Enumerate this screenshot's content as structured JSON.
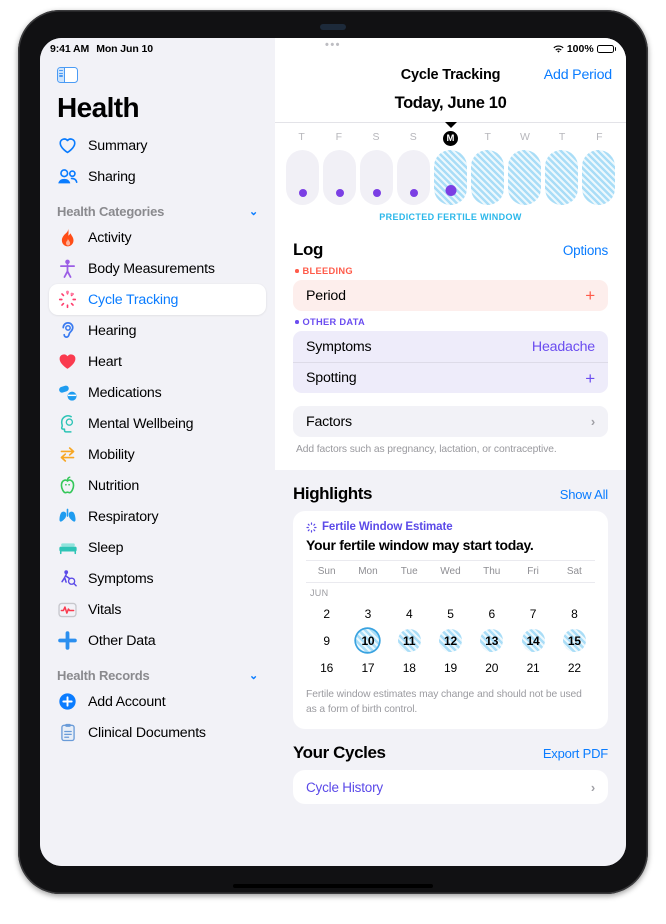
{
  "statusbar": {
    "time": "9:41 AM",
    "date": "Mon Jun 10",
    "dots": "•••",
    "battery_pct": "100%",
    "wifi_icon": "wifi-icon",
    "battery_icon": "battery-icon"
  },
  "sidebar": {
    "toggle_icon": "sidebar-toggle-icon",
    "app_title": "Health",
    "top_items": [
      {
        "label": "Summary",
        "icon": "heart-outline-icon",
        "color": "#0a7cff"
      },
      {
        "label": "Sharing",
        "icon": "people-icon",
        "color": "#0a7cff"
      }
    ],
    "categories_header": {
      "label": "Health Categories",
      "chevron": "chevron-down-icon"
    },
    "categories": [
      {
        "label": "Activity",
        "icon": "flame-icon",
        "color": "#ff4d17"
      },
      {
        "label": "Body Measurements",
        "icon": "body-icon",
        "color": "#9b5de5"
      },
      {
        "label": "Cycle Tracking",
        "icon": "cycle-icon",
        "color": "#ff3b6b",
        "selected": true
      },
      {
        "label": "Hearing",
        "icon": "ear-icon",
        "color": "#3a7bf0"
      },
      {
        "label": "Heart",
        "icon": "heart-filled-icon",
        "color": "#fa3b4f"
      },
      {
        "label": "Medications",
        "icon": "pills-icon",
        "color": "#1f9cf0"
      },
      {
        "label": "Mental Wellbeing",
        "icon": "head-icon",
        "color": "#2ec4b6"
      },
      {
        "label": "Mobility",
        "icon": "arrows-icon",
        "color": "#f7a623"
      },
      {
        "label": "Nutrition",
        "icon": "apple-icon",
        "color": "#34c759"
      },
      {
        "label": "Respiratory",
        "icon": "lungs-icon",
        "color": "#1f9cf0"
      },
      {
        "label": "Sleep",
        "icon": "bed-icon",
        "color": "#2ec4b6"
      },
      {
        "label": "Symptoms",
        "icon": "symptoms-icon",
        "color": "#5b4ae8"
      },
      {
        "label": "Vitals",
        "icon": "vitals-icon",
        "color": "#fa3b4f"
      },
      {
        "label": "Other Data",
        "icon": "plus-icon",
        "color": "#2b8fef"
      }
    ],
    "records_header": {
      "label": "Health Records",
      "chevron": "chevron-down-icon"
    },
    "records": [
      {
        "label": "Add Account",
        "icon": "add-circle-icon",
        "color": "#0a7cff"
      },
      {
        "label": "Clinical Documents",
        "icon": "clipboard-icon",
        "color": "#6a9bd8"
      }
    ]
  },
  "navbar": {
    "title": "Cycle Tracking",
    "action_label": "Add Period"
  },
  "today": {
    "label": "Today, June 10",
    "caret": "caret-down-icon"
  },
  "daystrip": {
    "days": [
      {
        "dow": "T",
        "fertile": false,
        "dot": true,
        "today": false
      },
      {
        "dow": "F",
        "fertile": false,
        "dot": true,
        "today": false
      },
      {
        "dow": "S",
        "fertile": false,
        "dot": true,
        "today": false
      },
      {
        "dow": "S",
        "fertile": false,
        "dot": true,
        "today": false
      },
      {
        "dow": "M",
        "fertile": true,
        "dot": true,
        "today": true
      },
      {
        "dow": "T",
        "fertile": true,
        "dot": false,
        "today": false
      },
      {
        "dow": "W",
        "fertile": true,
        "dot": false,
        "today": false
      },
      {
        "dow": "T",
        "fertile": true,
        "dot": false,
        "today": false
      },
      {
        "dow": "F",
        "fertile": true,
        "dot": false,
        "today": false
      }
    ],
    "fertile_label": "PREDICTED FERTILE WINDOW",
    "fertile_color": "#2ab7ea",
    "dot_color": "#7b3fe4"
  },
  "log": {
    "title": "Log",
    "options_label": "Options",
    "bleeding_group": "BLEEDING",
    "bleeding_rows": [
      {
        "label": "Period",
        "value": "+",
        "type": "add"
      }
    ],
    "other_group": "OTHER DATA",
    "other_rows": [
      {
        "label": "Symptoms",
        "value": "Headache",
        "type": "value"
      },
      {
        "label": "Spotting",
        "value": "+",
        "type": "add"
      }
    ],
    "factors_label": "Factors",
    "factors_chevron": "chevron-right-icon",
    "footnote": "Add factors such as pregnancy, lactation, or contraceptive."
  },
  "highlights": {
    "title": "Highlights",
    "show_all_label": "Show All",
    "card": {
      "kicker": "Fertile Window Estimate",
      "kicker_icon": "cycle-icon",
      "headline": "Your fertile window may start today.",
      "dow_labels": [
        "Sun",
        "Mon",
        "Tue",
        "Wed",
        "Thu",
        "Fri",
        "Sat"
      ],
      "month_label": "JUN",
      "weeks": [
        [
          {
            "n": "2",
            "fert": false,
            "today": false
          },
          {
            "n": "3",
            "fert": false,
            "today": false
          },
          {
            "n": "4",
            "fert": false,
            "today": false
          },
          {
            "n": "5",
            "fert": false,
            "today": false
          },
          {
            "n": "6",
            "fert": false,
            "today": false
          },
          {
            "n": "7",
            "fert": false,
            "today": false
          },
          {
            "n": "8",
            "fert": false,
            "today": false
          }
        ],
        [
          {
            "n": "9",
            "fert": false,
            "today": false
          },
          {
            "n": "10",
            "fert": true,
            "today": true
          },
          {
            "n": "11",
            "fert": true,
            "today": false
          },
          {
            "n": "12",
            "fert": true,
            "today": false
          },
          {
            "n": "13",
            "fert": true,
            "today": false
          },
          {
            "n": "14",
            "fert": true,
            "today": false
          },
          {
            "n": "15",
            "fert": true,
            "today": false
          }
        ],
        [
          {
            "n": "16",
            "fert": false,
            "today": false
          },
          {
            "n": "17",
            "fert": false,
            "today": false
          },
          {
            "n": "18",
            "fert": false,
            "today": false
          },
          {
            "n": "19",
            "fert": false,
            "today": false
          },
          {
            "n": "20",
            "fert": false,
            "today": false
          },
          {
            "n": "21",
            "fert": false,
            "today": false
          },
          {
            "n": "22",
            "fert": false,
            "today": false
          }
        ]
      ],
      "note": "Fertile window estimates may change and should not be used as a form of birth control."
    }
  },
  "your_cycles": {
    "title": "Your Cycles",
    "export_label": "Export PDF",
    "history_label": "Cycle History",
    "history_chevron": "chevron-right-icon"
  }
}
